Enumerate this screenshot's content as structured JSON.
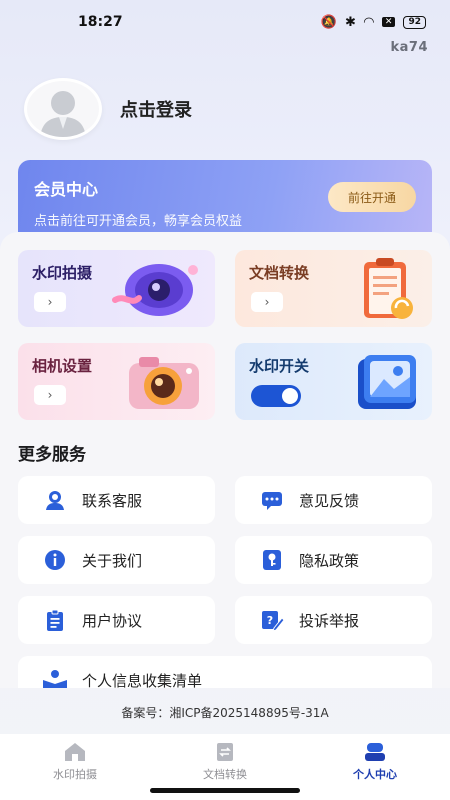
{
  "status_bar": {
    "time": "18:27",
    "battery": "92"
  },
  "version": "ka74",
  "profile": {
    "login_text": "点击登录"
  },
  "vip": {
    "title": "会员中心",
    "subtitle": "点击前往可开通会员，畅享会员权益",
    "button": "前往开通"
  },
  "features": [
    {
      "title": "水印拍摄",
      "action": "›",
      "icon": "camera-lens-icon"
    },
    {
      "title": "文档转换",
      "action": "›",
      "icon": "clipboard-icon"
    },
    {
      "title": "相机设置",
      "action": "›",
      "icon": "camera-icon"
    },
    {
      "title": "水印开关",
      "toggle_on": true,
      "icon": "image-icon"
    }
  ],
  "more_services": {
    "title": "更多服务",
    "items": [
      {
        "label": "联系客服",
        "icon": "customer-service-icon"
      },
      {
        "label": "意见反馈",
        "icon": "feedback-icon"
      },
      {
        "label": "关于我们",
        "icon": "info-icon"
      },
      {
        "label": "隐私政策",
        "icon": "privacy-key-icon"
      },
      {
        "label": "用户协议",
        "icon": "agreement-clipboard-icon"
      },
      {
        "label": "投诉举报",
        "icon": "report-edit-icon"
      },
      {
        "label": "个人信息收集清单",
        "icon": "personal-info-icon"
      }
    ]
  },
  "icp": "备案号：湘ICP备2025148895号-31A",
  "nav": [
    {
      "label": "水印拍摄",
      "icon": "home-icon",
      "active": false
    },
    {
      "label": "文档转换",
      "icon": "document-convert-icon",
      "active": false
    },
    {
      "label": "个人中心",
      "icon": "profile-icon",
      "active": true
    }
  ],
  "colors": {
    "accent": "#1f3fb0",
    "vip_gradient_start": "#6f86ee",
    "toggle": "#1d55d4"
  }
}
